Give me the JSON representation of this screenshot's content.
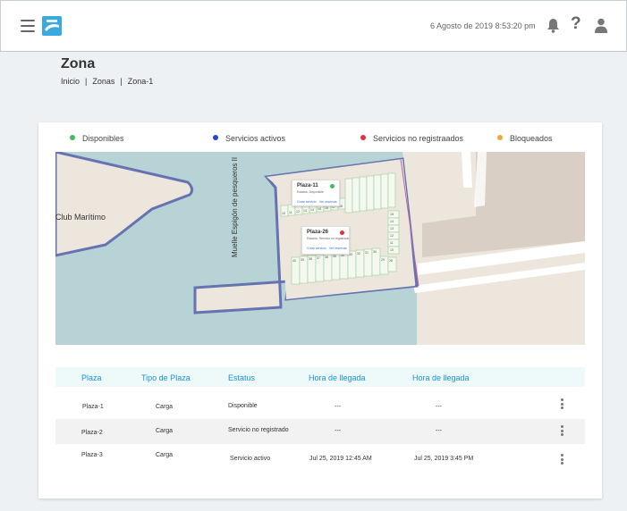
{
  "header": {
    "datetime": "6 Agosto de 2019 8:53:20 pm",
    "help_glyph": "?"
  },
  "page": {
    "title": "Zona",
    "breadcrumb": [
      "Inicio",
      "Zonas",
      "Zona-1"
    ]
  },
  "legend": [
    {
      "label": "Disponibles",
      "color": "#3cbf5a"
    },
    {
      "label": "Servicios activos",
      "color": "#2345d6"
    },
    {
      "label": "Servicios no registraados",
      "color": "#e0323a"
    },
    {
      "label": "Bloqueados",
      "color": "#f5a33b"
    }
  ],
  "map": {
    "club_label": "Club Marítimo",
    "muelle_label": "Muelle Espigón de pesqueros II",
    "popups": [
      {
        "title": "Plaza-11",
        "status": "Estatus: Disponible",
        "action1": "Crear servicio",
        "action2": "Ver reservas",
        "color": "#3cbf5a"
      },
      {
        "title": "Plaza-26",
        "status": "Estatus: Servicio no registrado",
        "action1": "Crear servicio",
        "action2": "Ver reservas",
        "color": "#e0323a"
      }
    ],
    "upper_slots": [
      "10",
      "11",
      "12",
      "13",
      "14",
      "15",
      "16",
      "17",
      "18",
      "19",
      "20"
    ],
    "right_slots": [
      "15",
      "14",
      "13",
      "12",
      "11",
      "10"
    ],
    "lower_slots": [
      "40",
      "39",
      "38",
      "37",
      "36",
      "35",
      "34",
      "33",
      "32",
      "31",
      "30",
      "29",
      "28",
      "27",
      "26",
      "25",
      "24"
    ]
  },
  "table": {
    "headers": [
      "Plaza",
      "Tipo de Plaza",
      "Estatus",
      "Hora de llegada",
      "Hora de llegada"
    ],
    "rows": [
      [
        "Plaza-1",
        "Carga",
        "Disponible",
        "---",
        "---"
      ],
      [
        "Plaza-2",
        "Carga",
        "Servicio no registrado",
        "---",
        "---"
      ],
      [
        "Plaza-3",
        "Carga",
        "Servicio activo",
        "Jul 25, 2019 12:45 AM",
        "Jul 25, 2019 3:45 PM"
      ]
    ]
  }
}
